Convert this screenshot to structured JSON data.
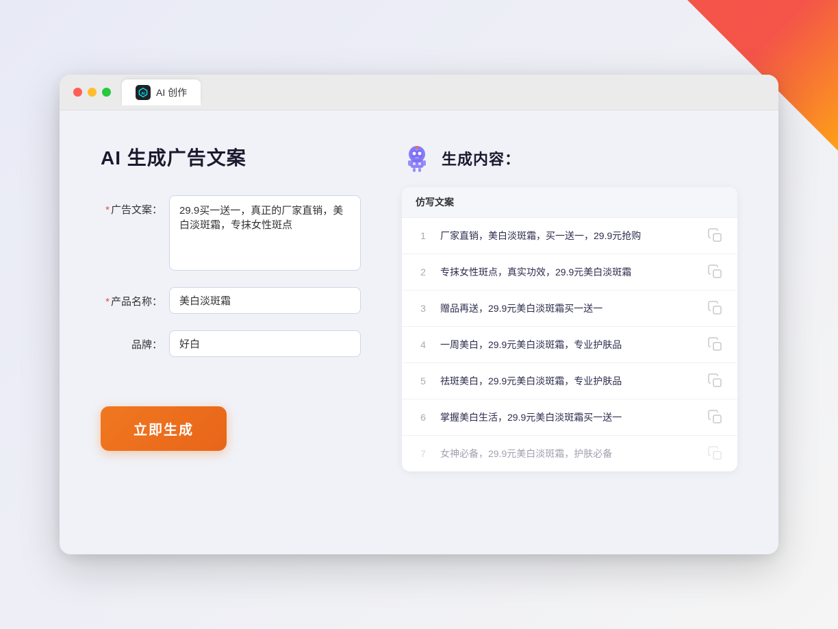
{
  "browser": {
    "tab_title": "AI 创作",
    "ai_tab_icon_text": "AI"
  },
  "page": {
    "title": "AI 生成广告文案",
    "result_title": "生成内容："
  },
  "form": {
    "ad_copy_label": "广告文案：",
    "ad_copy_required": "*",
    "ad_copy_value": "29.9买一送一，真正的厂家直销，美白淡斑霜，专抹女性斑点",
    "product_name_label": "产品名称：",
    "product_name_required": "*",
    "product_name_value": "美白淡斑霜",
    "brand_label": "品牌：",
    "brand_value": "好白",
    "generate_button": "立即生成"
  },
  "results": {
    "header_label": "仿写文案",
    "items": [
      {
        "number": "1",
        "content": "厂家直销，美白淡斑霜，买一送一，29.9元抢购",
        "dimmed": false
      },
      {
        "number": "2",
        "content": "专抹女性斑点，真实功效，29.9元美白淡斑霜",
        "dimmed": false
      },
      {
        "number": "3",
        "content": "赠品再送，29.9元美白淡斑霜买一送一",
        "dimmed": false
      },
      {
        "number": "4",
        "content": "一周美白，29.9元美白淡斑霜，专业护肤品",
        "dimmed": false
      },
      {
        "number": "5",
        "content": "祛斑美白，29.9元美白淡斑霜，专业护肤品",
        "dimmed": false
      },
      {
        "number": "6",
        "content": "掌握美白生活，29.9元美白淡斑霜买一送一",
        "dimmed": false
      },
      {
        "number": "7",
        "content": "女神必备，29.9元美白淡斑霜，护肤必备",
        "dimmed": true
      }
    ]
  }
}
